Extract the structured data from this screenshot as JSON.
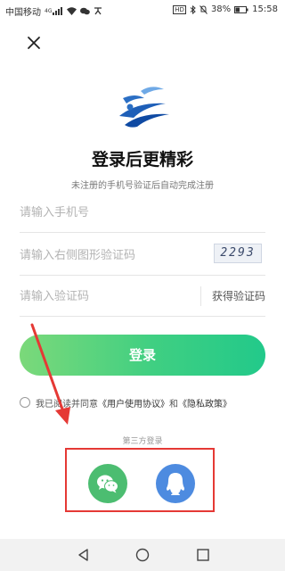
{
  "status_bar": {
    "carrier": "中国移动",
    "network_sup": "4G",
    "hd_badge": "HD",
    "battery": "38%",
    "time": "15:58"
  },
  "login": {
    "title": "登录后更精彩",
    "subtitle": "未注册的手机号验证后自动完成注册",
    "phone_placeholder": "请输入手机号",
    "captcha_placeholder": "请输入右侧图形验证码",
    "captcha_text": "2293",
    "code_placeholder": "请输入验证码",
    "get_code_label": "获得验证码",
    "login_button_label": "登录"
  },
  "agreement": {
    "prefix": "我已阅读并同意",
    "user_agreement": "《用户使用协议》",
    "and": "和",
    "privacy_policy": "《隐私政策》"
  },
  "third_party": {
    "label": "第三方登录",
    "providers": [
      "wechat-icon",
      "qq-icon"
    ]
  },
  "colors": {
    "login_gradient_start": "#7bd97a",
    "login_gradient_end": "#22c98a",
    "wechat": "#4cbd71",
    "qq": "#4d8be0",
    "annotation": "#e53935"
  }
}
